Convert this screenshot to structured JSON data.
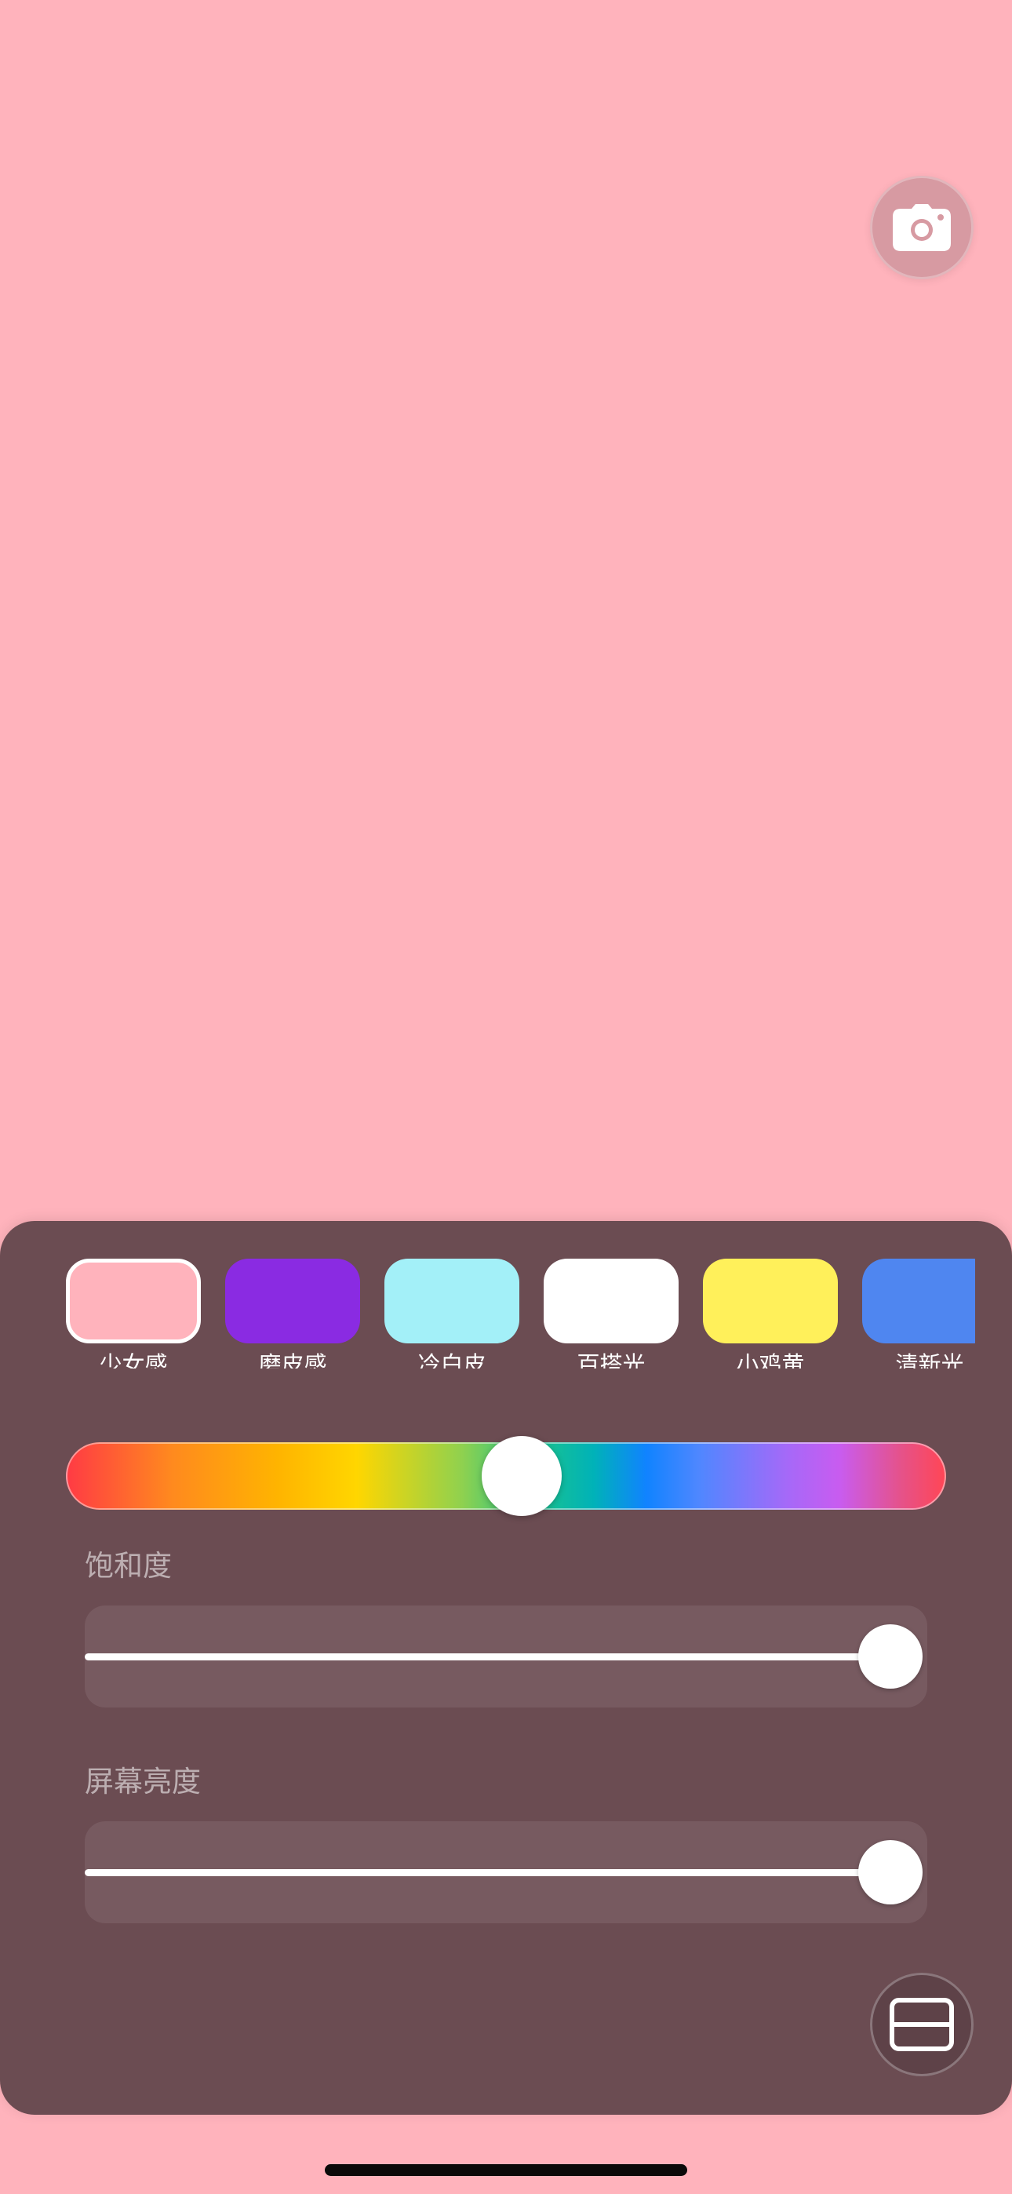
{
  "colors": {
    "background": "#FFB3BC",
    "panel": "#6B4C52",
    "slider_box": "#775A60",
    "accent": "#FFFFFF"
  },
  "camera_button": {
    "icon": "camera-icon"
  },
  "presets": [
    {
      "label": "少女感",
      "color": "#FFB3BC",
      "selected": true
    },
    {
      "label": "磨皮感",
      "color": "#8A2BE2",
      "selected": false
    },
    {
      "label": "冷白皮",
      "color": "#A3F0F8",
      "selected": false
    },
    {
      "label": "百搭光",
      "color": "#FFFFFF",
      "selected": false
    },
    {
      "label": "小鸡黄",
      "color": "#FFF05A",
      "selected": false
    },
    {
      "label": "清新光",
      "color": "#4F86F0",
      "selected": false
    }
  ],
  "hue_slider": {
    "value_fraction": 0.52
  },
  "saturation": {
    "label": "饱和度",
    "value_fraction": 1.0
  },
  "brightness": {
    "label": "屏幕亮度",
    "value_fraction": 1.0
  },
  "layout_button": {
    "icon": "split-layout-icon"
  }
}
